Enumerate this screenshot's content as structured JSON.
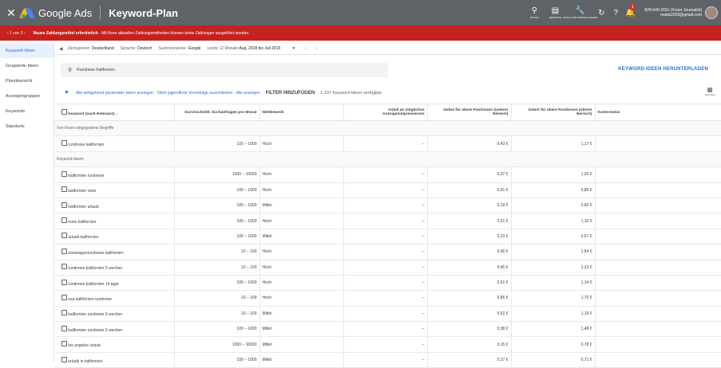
{
  "header": {
    "brand": "Google Ads",
    "page_title": "Keyword-Plan",
    "tools": [
      {
        "icon": "search-icon",
        "label": "SUCHE"
      },
      {
        "icon": "reports-icon",
        "label": "BERICHTE"
      },
      {
        "icon": "wrench-icon",
        "label": "TOOLS UND EINSTELLUNGEN"
      }
    ],
    "notification_count": "1",
    "account_line1": "829-640-2651 (Freier Journalist)",
    "account_line2": "maisk2003@gmail.com"
  },
  "alert": {
    "pager": "1 von 2",
    "title": "Neues Zahlungsmittel erforderlich",
    "message": " - Mit Ihren aktuellen Zahlungsmethoden können keine Zahlungen ausgeführt werden."
  },
  "sidebar": {
    "items": [
      {
        "label": "Keyword-Ideen",
        "active": true
      },
      {
        "label": "Gruppierte Ideen"
      },
      {
        "label": "Planübersicht"
      },
      {
        "label": "Anzeigengruppen"
      },
      {
        "label": "Keywords"
      },
      {
        "label": "Standorte"
      }
    ]
  },
  "filterbar": {
    "location_label": "Zielregionen:",
    "location_value": "Deutschland",
    "language_label": "Sprache:",
    "language_value": "Deutsch",
    "network_label": "Suchnetzwerke:",
    "network_value": "Google",
    "period_label": "Letzte 12 Monate",
    "period_value": "Aug. 2018 bis Juli 2019"
  },
  "search": {
    "value": "Rundreise Kalifornien"
  },
  "download_label": "KEYWORD-IDEEN HERUNTERLADEN",
  "filters": {
    "f1": "Alle weitgehend passenden Ideen anzeigen:",
    "f2": "Nicht jugendfreie Vorschläge ausschließen",
    "f3": "Alle anzeigen",
    "add": "FILTER HINZUFÜGEN",
    "count": "1.197 Keyword-Ideen verfügbar"
  },
  "columns_label": "SPALTEN",
  "table": {
    "headers": [
      "Keyword (nach Relevanz)",
      "Durchschnittl. Suchanfragen pro Monat",
      "Wettbewerb",
      "Anteil an möglichen Anzeigenimpressionen",
      "Gebot für obere Positionen (unterer Bereich)",
      "Gebot für obere Positionen (oberer Bereich)",
      "Kontostatus"
    ],
    "group1": "Von Ihnen eingegebene Begriffe",
    "entered": [
      {
        "kw": "rundreise kalifornien",
        "vol": "100 – 1000",
        "comp": "Hoch",
        "share": "–",
        "low": "0,43 €",
        "high": "1,17 €"
      }
    ],
    "group2": "Keyword-Ideen",
    "ideas": [
      {
        "kw": "kalifornien rundreise",
        "vol": "1000 – 10000",
        "comp": "Hoch",
        "share": "–",
        "low": "0,37 €",
        "high": "1,00 €"
      },
      {
        "kw": "kalifornien reise",
        "vol": "100 – 1000",
        "comp": "Hoch",
        "share": "–",
        "low": "0,41 €",
        "high": "0,89 €"
      },
      {
        "kw": "kalifornien urlaub",
        "vol": "100 – 1000",
        "comp": "Mittel",
        "share": "–",
        "low": "0,19 €",
        "high": "0,60 €"
      },
      {
        "kw": "reise kalifornien",
        "vol": "100 – 1000",
        "comp": "Hoch",
        "share": "–",
        "low": "0,51 €",
        "high": "1,10 €"
      },
      {
        "kw": "urlaub kalifornien",
        "vol": "100 – 1000",
        "comp": "Mittel",
        "share": "–",
        "low": "0,23 €",
        "high": "0,67 €"
      },
      {
        "kw": "mietwagenrundreise kalifornien",
        "vol": "10 – 100",
        "comp": "Hoch",
        "share": "–",
        "low": "0,66 €",
        "high": "1,64 €"
      },
      {
        "kw": "rundreise kalifornien 2 wochen",
        "vol": "10 – 100",
        "comp": "Hoch",
        "share": "–",
        "low": "0,45 €",
        "high": "1,23 €"
      },
      {
        "kw": "rundreise kalifornien 14 tage",
        "vol": "100 – 1000",
        "comp": "Hoch",
        "share": "–",
        "low": "0,51 €",
        "high": "1,14 €"
      },
      {
        "kw": "usa kalifornien rundreise",
        "vol": "10 – 100",
        "comp": "Hoch",
        "share": "–",
        "low": "0,86 €",
        "high": "1,70 €"
      },
      {
        "kw": "kalifornien rundreise 3 wochen",
        "vol": "10 – 100",
        "comp": "Mittel",
        "share": "–",
        "low": "0,52 €",
        "high": "1,19 €"
      },
      {
        "kw": "kalifornien rundreise 2 wochen",
        "vol": "100 – 1000",
        "comp": "Mittel",
        "share": "–",
        "low": "0,38 €",
        "high": "1,48 €"
      },
      {
        "kw": "los angeles urlaub",
        "vol": "1000 – 10000",
        "comp": "Mittel",
        "share": "–",
        "low": "0,15 €",
        "high": "0,78 €"
      },
      {
        "kw": "urlaub in kalifornien",
        "vol": "100 – 1000",
        "comp": "Mittel",
        "share": "–",
        "low": "0,27 €",
        "high": "0,71 €"
      }
    ]
  }
}
